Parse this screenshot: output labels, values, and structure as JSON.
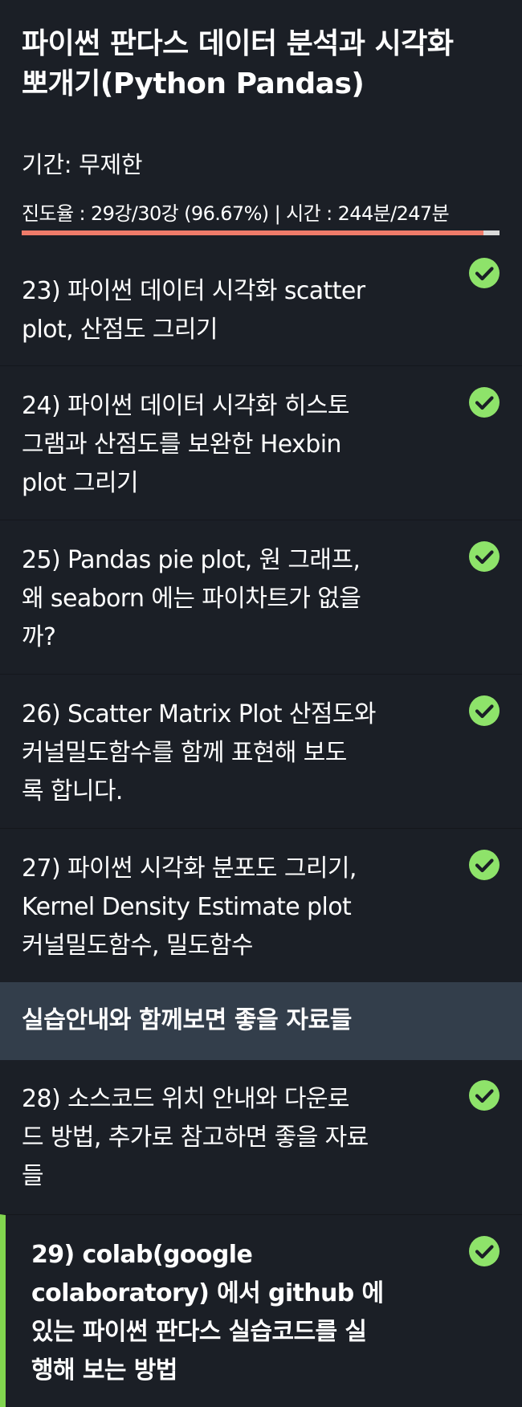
{
  "course": {
    "title_line1": "파이썬 판다스 데이터 분석과 시각화",
    "title_line2": "뽀개기(Python Pandas)",
    "period": "기간: 무제한",
    "progress_text": "진도율 : 29강/30강 (96.67%) | 시간 : 244분/247분",
    "progress_fraction": 0.9667
  },
  "colors": {
    "background": "#1b1f26",
    "section_background": "#333e4b",
    "progress_fill": "#ef7b6a",
    "progress_track": "#d9d9d9",
    "check_green": "#8ee36a",
    "current_marker": "#82d64f"
  },
  "lessons": [
    {
      "lines": [
        "23) 파이썬 데이터 시각화 scatter",
        "plot, 산점도 그리기"
      ],
      "icon": "check-circle-icon",
      "completed": true
    },
    {
      "lines": [
        "24) 파이썬 데이터 시각화 히스토",
        "그램과 산점도를 보완한 Hexbin",
        "plot 그리기"
      ],
      "icon": "check-circle-icon",
      "completed": true
    },
    {
      "lines": [
        "25) Pandas pie plot, 원 그래프,",
        "왜 seaborn 에는 파이차트가 없을",
        "까?"
      ],
      "icon": "check-circle-icon",
      "completed": true
    },
    {
      "lines": [
        "26) Scatter Matrix Plot 산점도와",
        "커널밀도함수를 함께 표현해 보도",
        "록 합니다."
      ],
      "icon": "check-circle-icon",
      "completed": true
    },
    {
      "lines": [
        "27) 파이썬 시각화 분포도 그리기,",
        "Kernel Density Estimate plot",
        "커널밀도함수, 밀도함수"
      ],
      "icon": "check-circle-icon",
      "completed": true
    }
  ],
  "section": {
    "title": "실습안내와 함께보면 좋을 자료들"
  },
  "section_lessons": [
    {
      "lines": [
        "28) 소스코드 위치 안내와 다운로",
        "드 방법, 추가로 참고하면 좋을 자료",
        "들"
      ],
      "icon": "check-circle-icon",
      "completed": true
    },
    {
      "lines": [
        "29) colab(google",
        "colaboratory) 에서 github 에",
        "있는 파이썬 판다스 실습코드를 실",
        "행해 보는 방법"
      ],
      "icon": "check-circle-icon",
      "completed": true,
      "current": true
    }
  ]
}
